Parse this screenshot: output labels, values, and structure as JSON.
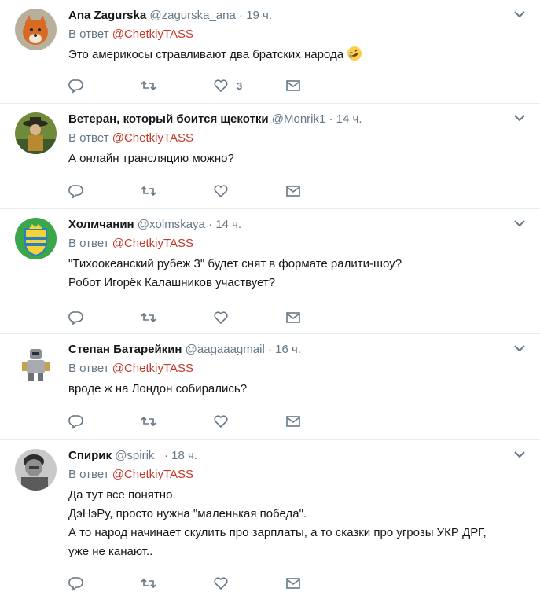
{
  "reply_prefix": "В ответ",
  "reply_mention": "@ChetkiyTASS",
  "tweets": [
    {
      "name": "Ana Zagurska",
      "handle": "@zagurska_ana",
      "time": "19 ч.",
      "lines": [
        "Это америкосы стравливают два братских народа"
      ],
      "emoji": "rolling-on-floor-laughing",
      "like_count": "3"
    },
    {
      "name": "Ветеран, который боится щекотки",
      "handle": "@Monrik1",
      "time": "14 ч.",
      "lines": [
        "А онлайн трансляцию можно?"
      ],
      "like_count": ""
    },
    {
      "name": "Холмчанин",
      "handle": "@xolmskaya",
      "time": "14 ч.",
      "lines": [
        "\"Тихоокеанский рубеж 3\" будет снят в формате ралити-шоу?",
        "Робот Игорёк Калашников участвует?"
      ],
      "like_count": ""
    },
    {
      "name": "Степан Батарейкин",
      "handle": "@aagaaagmail",
      "time": "16 ч.",
      "lines": [
        "вроде ж на Лондон собирались?"
      ],
      "like_count": ""
    },
    {
      "name": "Спирик",
      "handle": "@spirik_",
      "time": "18 ч.",
      "lines": [
        "Да тут все понятно.",
        "ДэНэРу, просто нужна \"маленькая победа\".",
        "А то народ начинает скулить про зарплаты, а то сказки про угрозы УКР ДРГ,",
        "уже не канают.."
      ],
      "like_count": ""
    }
  ],
  "colors": {
    "mention": "#c0392b",
    "muted": "#657786",
    "border": "#e6ecf0",
    "icon": "#657786"
  }
}
